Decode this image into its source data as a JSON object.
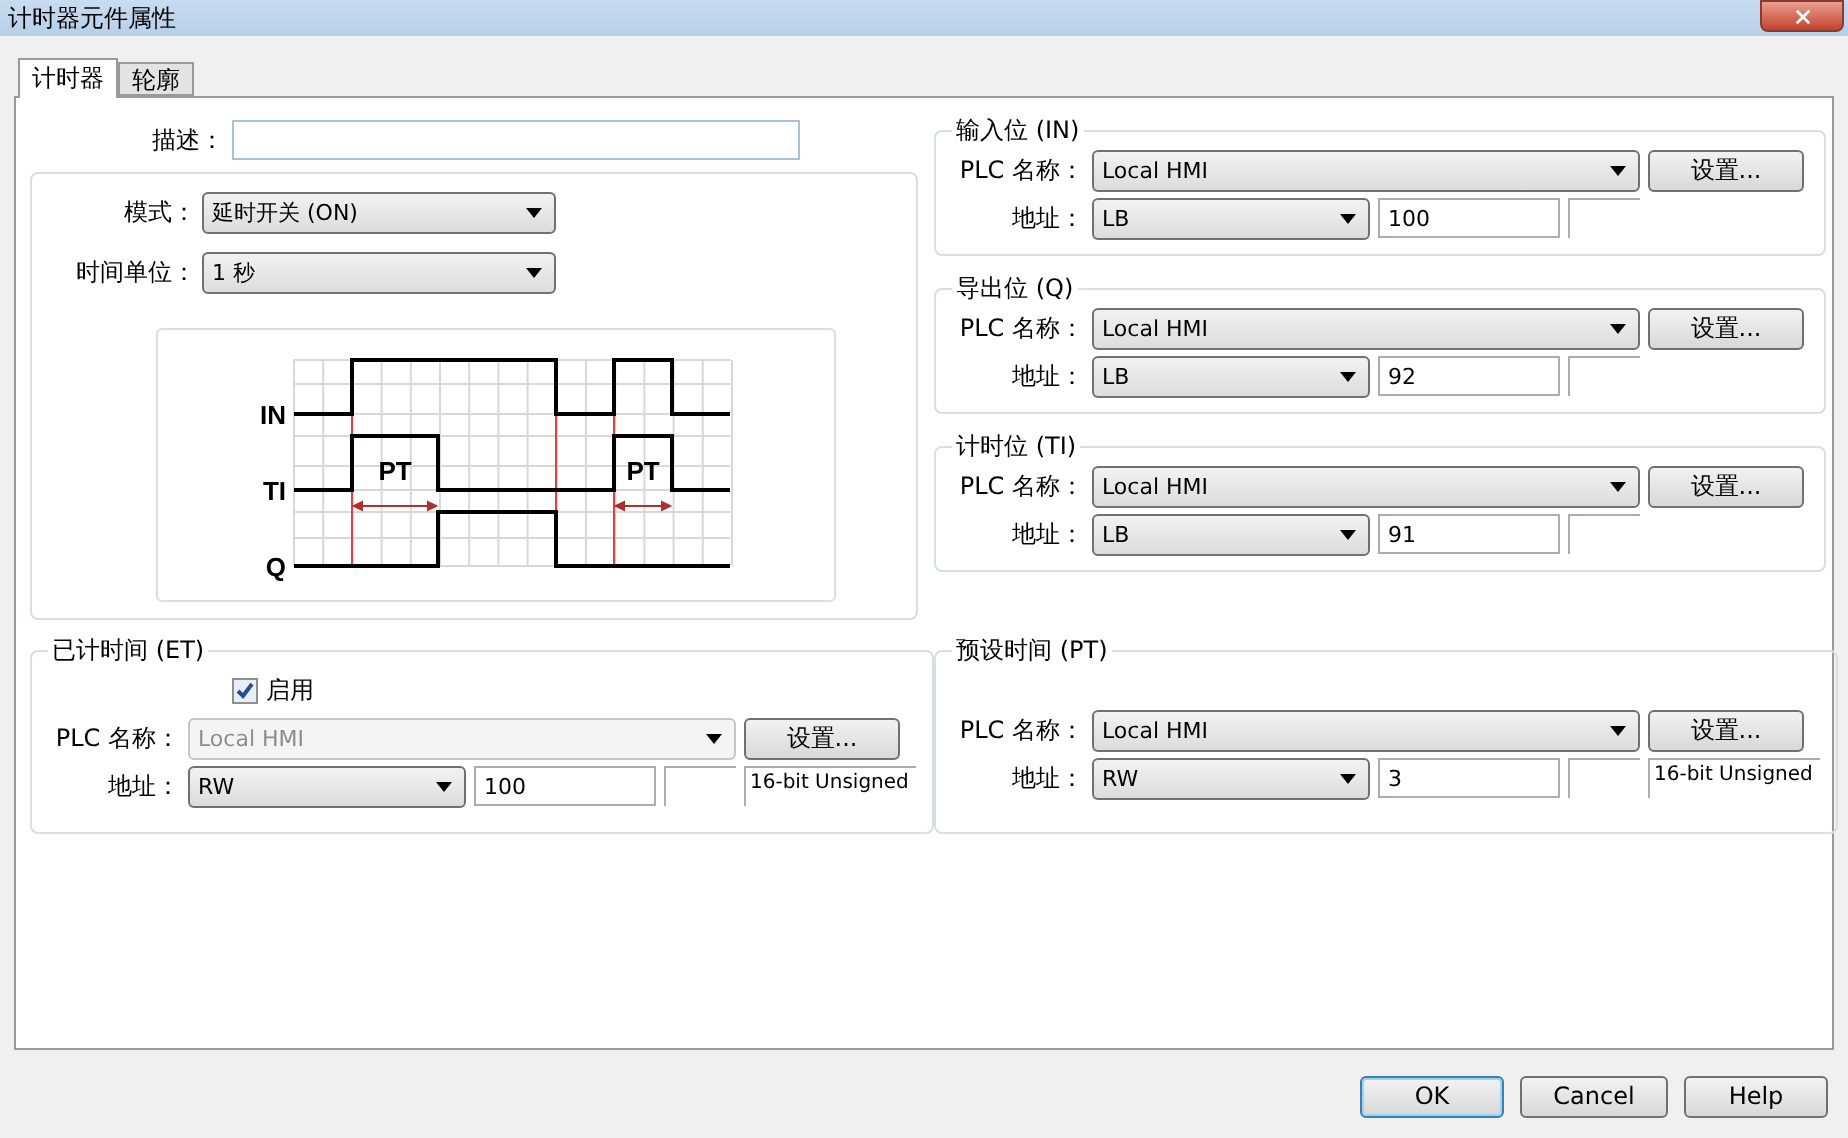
{
  "window": {
    "title": "计时器元件属性"
  },
  "tabs": [
    {
      "label": "计时器",
      "selected": true
    },
    {
      "label": "轮廓",
      "selected": false
    }
  ],
  "description": {
    "label": "描述："
  },
  "mode": {
    "label": "模式：",
    "value": "延时开关 (ON)"
  },
  "time_unit": {
    "label": "时间单位：",
    "value": "1 秒"
  },
  "diagram": {
    "signals": [
      "IN",
      "TI",
      "Q"
    ],
    "pulse_labels": [
      "PT",
      "PT"
    ]
  },
  "right_groups": [
    {
      "title": "输入位 (IN)",
      "plc": {
        "label": "PLC 名称：",
        "value": "Local HMI",
        "disabled": false
      },
      "settings": "设置...",
      "address": {
        "label": "地址：",
        "device": "LB",
        "value": "100"
      }
    },
    {
      "title": "导出位 (Q)",
      "plc": {
        "label": "PLC 名称：",
        "value": "Local HMI",
        "disabled": false
      },
      "settings": "设置...",
      "address": {
        "label": "地址：",
        "device": "LB",
        "value": "92"
      }
    },
    {
      "title": "计时位 (TI)",
      "plc": {
        "label": "PLC 名称：",
        "value": "Local HMI",
        "disabled": false
      },
      "settings": "设置...",
      "address": {
        "label": "地址：",
        "device": "LB",
        "value": "91"
      }
    }
  ],
  "elapsed": {
    "title": "已计时间 (ET)",
    "enable": {
      "label": "启用",
      "checked": true
    },
    "plc": {
      "label": "PLC 名称：",
      "value": "Local HMI",
      "disabled": true
    },
    "settings": "设置...",
    "address": {
      "label": "地址：",
      "device": "RW",
      "value": "100"
    },
    "data_type": "16-bit Unsigned"
  },
  "preset": {
    "title": "预设时间 (PT)",
    "plc": {
      "label": "PLC 名称：",
      "value": "Local HMI",
      "disabled": false
    },
    "settings": "设置...",
    "address": {
      "label": "地址：",
      "device": "RW",
      "value": "3"
    },
    "data_type": "16-bit Unsigned"
  },
  "buttons": [
    {
      "label": "OK",
      "default": true
    },
    {
      "label": "Cancel",
      "default": false
    },
    {
      "label": "Help",
      "default": false
    }
  ]
}
